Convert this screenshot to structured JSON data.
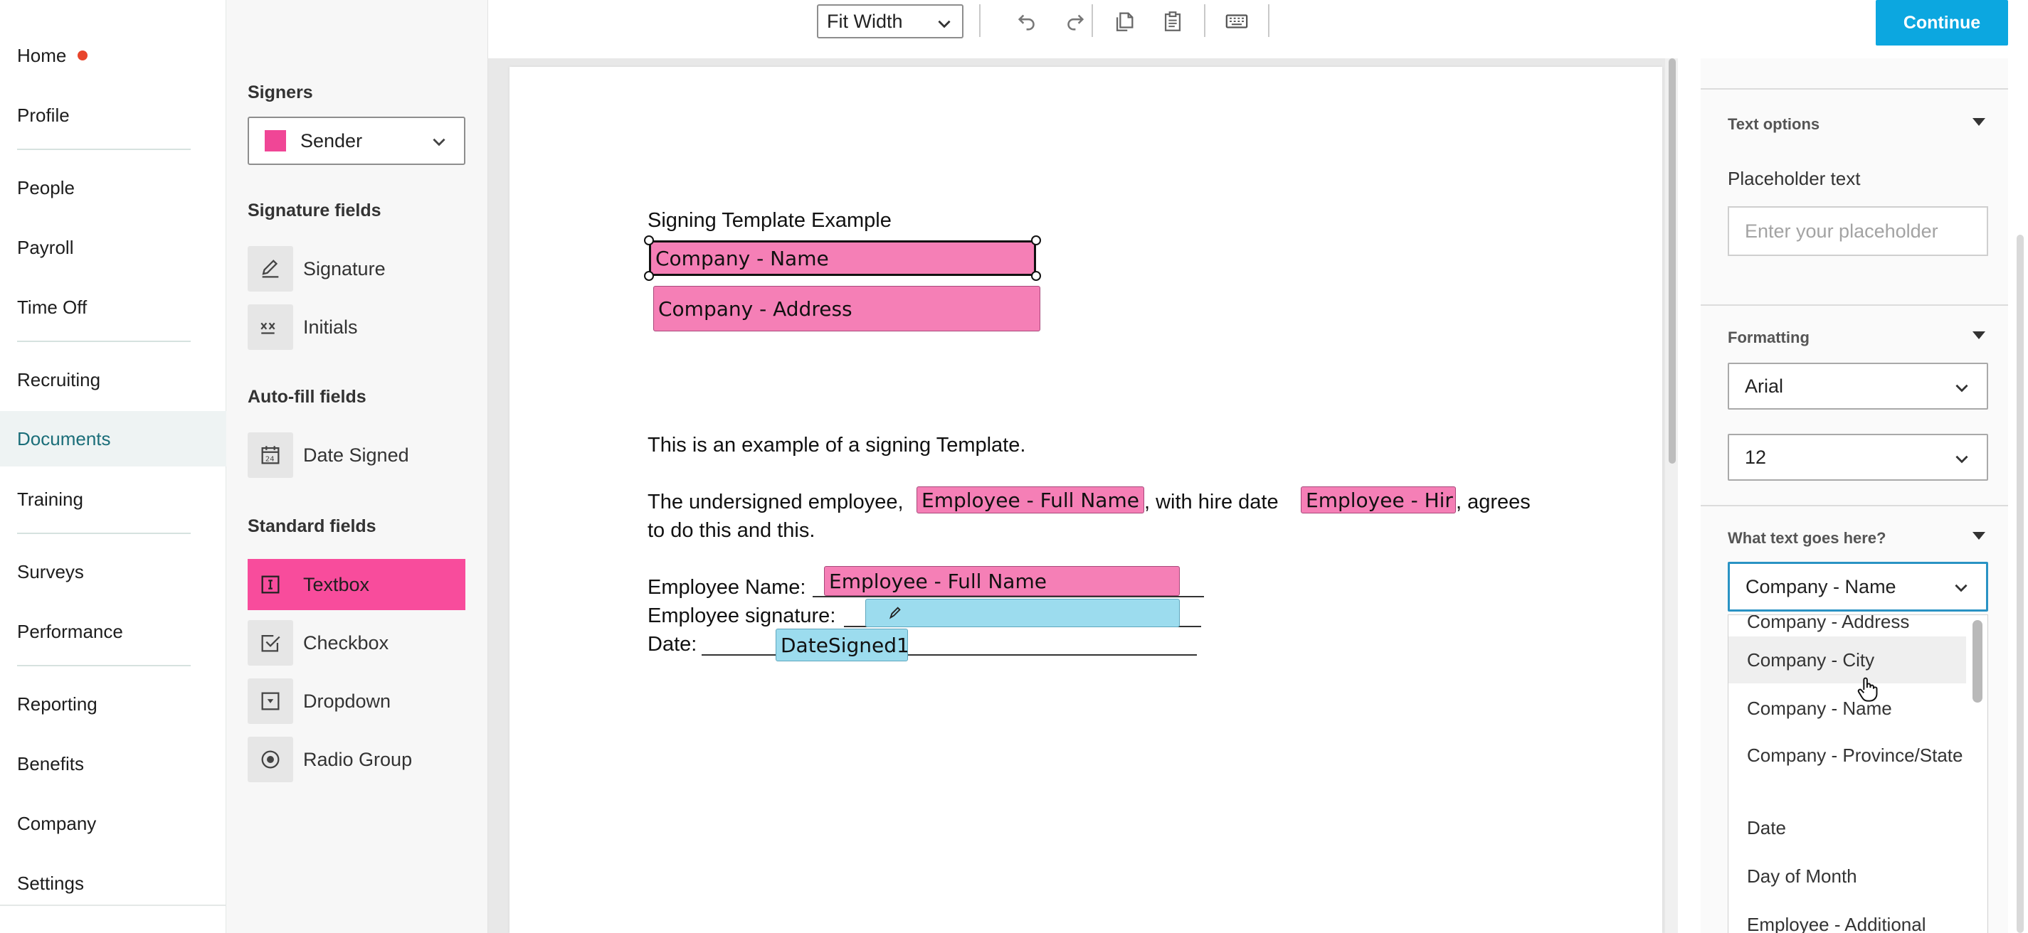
{
  "nav": {
    "items": [
      {
        "label": "Home",
        "dot": true
      },
      {
        "label": "Profile"
      },
      {
        "label": "People"
      },
      {
        "label": "Payroll"
      },
      {
        "label": "Time Off"
      },
      {
        "label": "Recruiting"
      },
      {
        "label": "Documents",
        "active": true
      },
      {
        "label": "Training"
      },
      {
        "label": "Surveys"
      },
      {
        "label": "Performance"
      },
      {
        "label": "Reporting"
      },
      {
        "label": "Benefits"
      },
      {
        "label": "Company"
      },
      {
        "label": "Settings"
      }
    ]
  },
  "fields_panel": {
    "signers_title": "Signers",
    "signer_selected": "Sender",
    "signer_color": "#f04696",
    "signature_title": "Signature fields",
    "signature_fields": [
      {
        "label": "Signature",
        "icon": "pen-icon"
      },
      {
        "label": "Initials",
        "icon": "initials-icon"
      }
    ],
    "autofill_title": "Auto-fill fields",
    "autofill_fields": [
      {
        "label": "Date Signed",
        "icon": "calendar-icon"
      }
    ],
    "standard_title": "Standard fields",
    "standard_fields": [
      {
        "label": "Textbox",
        "icon": "textbox-icon",
        "selected": true
      },
      {
        "label": "Checkbox",
        "icon": "checkbox-icon"
      },
      {
        "label": "Dropdown",
        "icon": "dropdown-icon"
      },
      {
        "label": "Radio Group",
        "icon": "radio-icon"
      }
    ]
  },
  "toolbar": {
    "zoom": "Fit Width",
    "continue_label": "Continue",
    "accent": "#0ca7e0"
  },
  "document": {
    "title": "Signing Template Example",
    "field_company_name": "Company - Name",
    "field_company_address": "Company - Address",
    "para1": "This is an example of a signing Template.",
    "para2_start": "The undersigned employee,",
    "field_employee_full_name": "Employee - Full Name",
    "para2_mid": ", with hire date",
    "field_employee_hire": "Employee - Hir",
    "para2_end": ", agrees",
    "para2_line2": "to do this and this.",
    "label_employee_name": "Employee Name:",
    "field_employee_name": "Employee - Full Name",
    "label_employee_signature": "Employee signature:",
    "label_date": "Date:",
    "field_date_signed": "DateSigned1"
  },
  "props": {
    "text_options_title": "Text options",
    "placeholder_label": "Placeholder text",
    "placeholder_hint": "Enter your placeholder",
    "formatting_title": "Formatting",
    "font_value": "Arial",
    "size_value": "12",
    "what_text_title": "What text goes here?",
    "what_text_value": "Company - Name",
    "options": [
      "Company - Address",
      "Company - City",
      "Company - Name",
      "Company - Province/State",
      "Date",
      "Day of Month",
      "Employee - Additional"
    ]
  }
}
